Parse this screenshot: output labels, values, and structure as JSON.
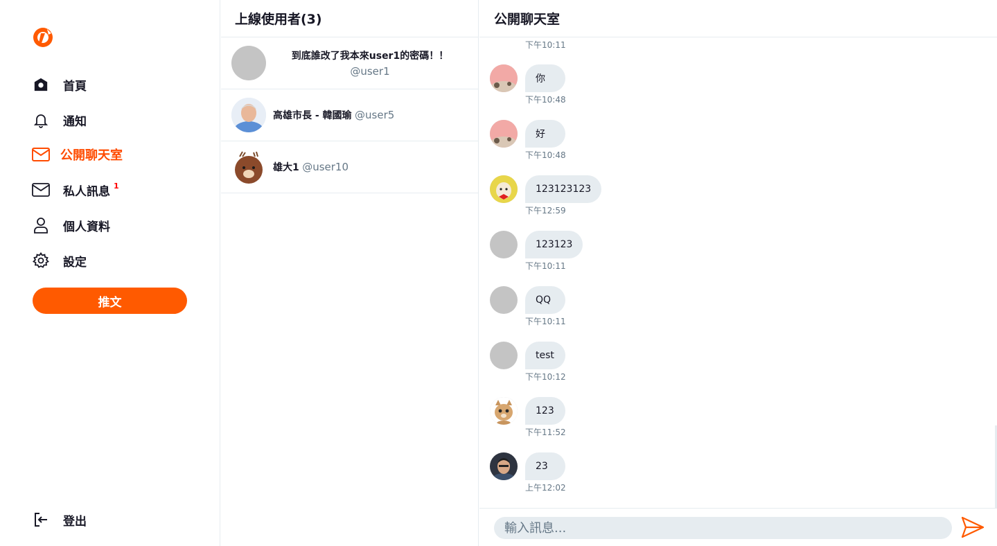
{
  "colors": {
    "accent": "#ff5a00",
    "active": "#ff4b00",
    "border": "#e6ecf0",
    "bubble": "#e6ecf0",
    "muted": "#657786",
    "badge": "#ff0000"
  },
  "sidebar": {
    "logo_icon": "brand-logo-icon",
    "items": [
      {
        "label": "首頁",
        "icon": "home-icon"
      },
      {
        "label": "通知",
        "icon": "bell-icon"
      },
      {
        "label": "公開聊天室",
        "icon": "mail-icon",
        "active": true
      },
      {
        "label": "私人訊息",
        "icon": "mail-icon",
        "badge": "1"
      },
      {
        "label": "個人資料",
        "icon": "user-icon"
      },
      {
        "label": "設定",
        "icon": "gear-icon"
      }
    ],
    "tweet_button": "推文",
    "logout": "登出"
  },
  "online": {
    "title": "上線使用者(3)",
    "users": [
      {
        "name": "到底誰改了我本來user1的密碼！！",
        "account": "@user1"
      },
      {
        "name": "高雄市長 - 韓國瑜",
        "account": "@user5"
      },
      {
        "name": "雄大1",
        "account": "@user10"
      }
    ]
  },
  "chat": {
    "title": "公開聊天室",
    "first_time": "下午10:11",
    "messages": [
      {
        "text": "你",
        "time": "下午10:48"
      },
      {
        "text": "好",
        "time": "下午10:48"
      },
      {
        "text": "123123123",
        "time": "下午12:59"
      },
      {
        "text": "123123",
        "time": "下午10:11"
      },
      {
        "text": "QQ",
        "time": "下午10:11"
      },
      {
        "text": "test",
        "time": "下午10:12"
      },
      {
        "text": "123",
        "time": "下午11:52"
      },
      {
        "text": "23",
        "time": "上午12:02"
      }
    ],
    "input_placeholder": "輸入訊息...",
    "send_icon": "send-icon"
  }
}
